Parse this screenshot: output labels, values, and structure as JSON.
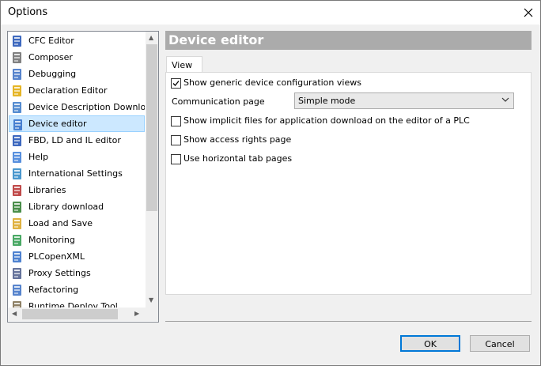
{
  "window": {
    "title": "Options"
  },
  "tree": {
    "items": [
      {
        "label": "CFC Editor",
        "icon": "cfc-editor-icon",
        "color": "#1c4fb4"
      },
      {
        "label": "Composer",
        "icon": "composer-icon",
        "color": "#6b6b6b"
      },
      {
        "label": "Debugging",
        "icon": "debugging-icon",
        "color": "#3a6fc4"
      },
      {
        "label": "Declaration Editor",
        "icon": "declaration-editor-icon",
        "color": "#e0a800"
      },
      {
        "label": "Device Description Download",
        "icon": "device-download-icon",
        "color": "#3778c8"
      },
      {
        "label": "Device editor",
        "icon": "device-editor-icon",
        "color": "#2f6cc8"
      },
      {
        "label": "FBD, LD and IL editor",
        "icon": "fbd-editor-icon",
        "color": "#1c4fb4"
      },
      {
        "label": "Help",
        "icon": "help-icon",
        "color": "#3b7dd8"
      },
      {
        "label": "International Settings",
        "icon": "globe-icon",
        "color": "#2a86c6"
      },
      {
        "label": "Libraries",
        "icon": "libraries-icon",
        "color": "#b52a2a"
      },
      {
        "label": "Library download",
        "icon": "library-download-icon",
        "color": "#2a7a2a"
      },
      {
        "label": "Load and Save",
        "icon": "folder-icon",
        "color": "#d9a520"
      },
      {
        "label": "Monitoring",
        "icon": "monitoring-icon",
        "color": "#2a9a4a"
      },
      {
        "label": "PLCopenXML",
        "icon": "plcopenxml-icon",
        "color": "#2f6cc8"
      },
      {
        "label": "Proxy Settings",
        "icon": "proxy-icon",
        "color": "#4a5a8a"
      },
      {
        "label": "Refactoring",
        "icon": "refactoring-icon",
        "color": "#3a6fc4"
      },
      {
        "label": "Runtime Deploy Tool",
        "icon": "runtime-deploy-icon",
        "color": "#7a6a4a"
      }
    ],
    "selected": "Device editor"
  },
  "panel": {
    "header": "Device editor",
    "tab": "View",
    "options": [
      {
        "label": "Show generic device configuration views",
        "checked": true
      },
      {
        "label": "Show implicit files for application download on the editor of a PLC",
        "checked": false
      },
      {
        "label": "Show access rights page",
        "checked": false
      },
      {
        "label": "Use horizontal tab pages",
        "checked": false
      }
    ],
    "communication": {
      "label": "Communication page",
      "value": "Simple mode"
    }
  },
  "buttons": {
    "ok": "OK",
    "cancel": "Cancel"
  },
  "colors": {
    "selection": "#cce8ff",
    "header_bg": "#ababab",
    "default_button_border": "#0078d7"
  }
}
